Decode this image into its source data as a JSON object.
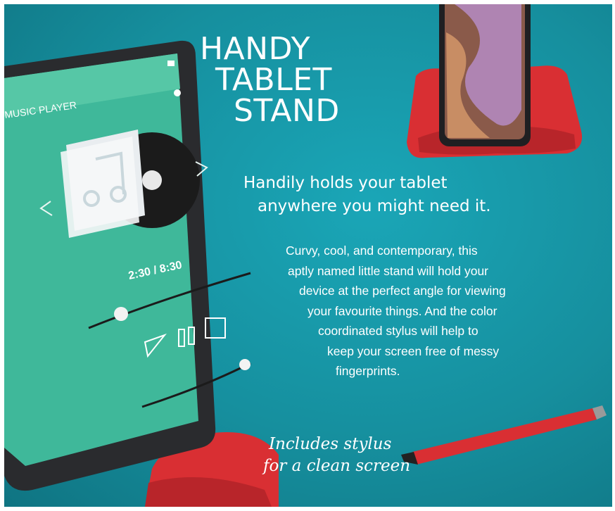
{
  "headline": [
    "HANDY",
    "TABLET",
    "STAND"
  ],
  "subheading": [
    "Handily holds your tablet",
    "anywhere you might need it."
  ],
  "body_lines": [
    "Curvy, cool, and contemporary, this",
    "aptly named little stand will hold your",
    "device at the perfect angle for viewing",
    "your favourite things. And the color",
    "coordinated stylus will help to",
    "keep your screen free of messy",
    "fingerprints."
  ],
  "caption": [
    "Includes stylus",
    "for a clean screen"
  ],
  "tablet_screen": {
    "app_title": "MUSIC PLAYER",
    "time_readout": "2:30 / 8:30"
  },
  "colors": {
    "background": "#168f9e",
    "stand": "#e5393b",
    "screen": "#3fb89a",
    "text": "#ffffff"
  }
}
